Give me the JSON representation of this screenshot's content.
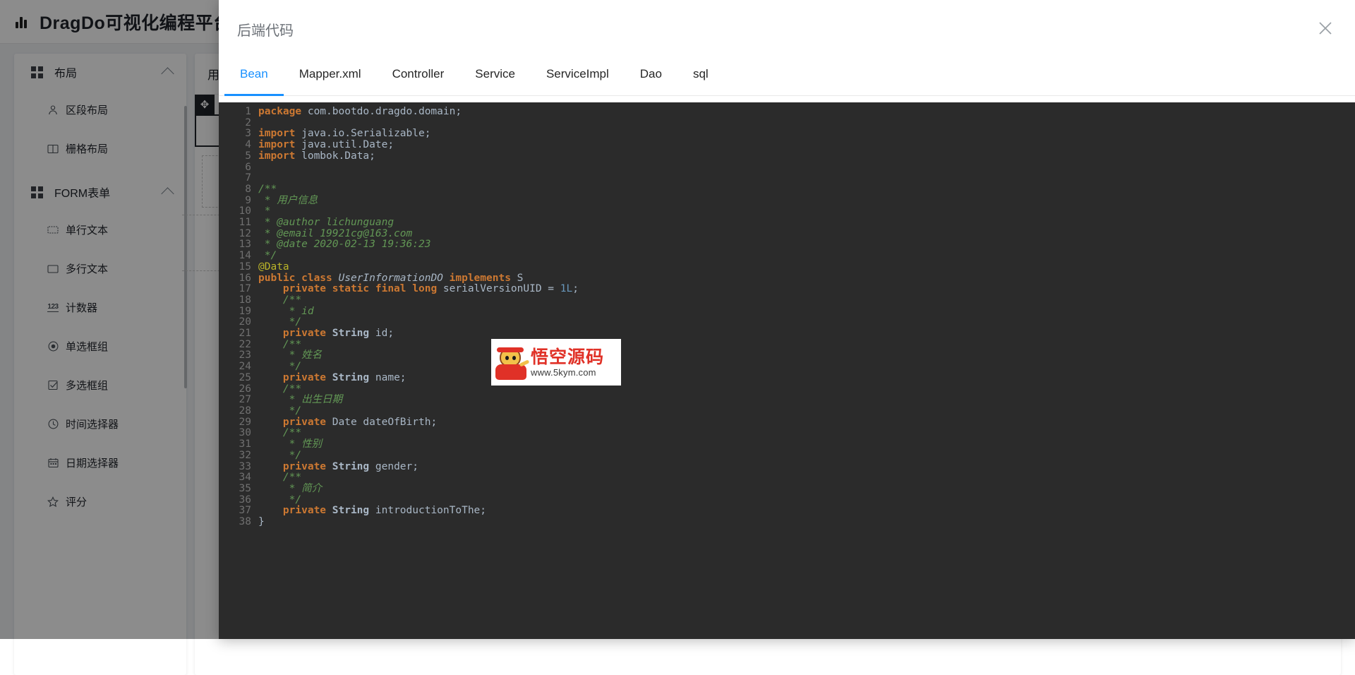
{
  "app": {
    "brand_title": "DragDo可视化编程平台",
    "brand_icon": "bar-chart-icon"
  },
  "sidebar": {
    "groups": [
      {
        "label": "布局",
        "icon": "grid-icon",
        "chevron": "chevron-up-icon",
        "items": [
          {
            "label": "区段布局",
            "icon": "person-icon"
          },
          {
            "label": "栅格布局",
            "icon": "columns-icon"
          }
        ]
      },
      {
        "label": "FORM表单",
        "icon": "grid-icon",
        "chevron": "chevron-up-icon",
        "items": [
          {
            "label": "单行文本",
            "icon": "input-icon"
          },
          {
            "label": "多行文本",
            "icon": "textarea-icon"
          },
          {
            "label": "计数器",
            "icon": "number-123-icon"
          },
          {
            "label": "单选框组",
            "icon": "radio-icon"
          },
          {
            "label": "多选框组",
            "icon": "checkbox-icon"
          },
          {
            "label": "时间选择器",
            "icon": "clock-icon"
          },
          {
            "label": "日期选择器",
            "icon": "calendar-icon"
          },
          {
            "label": "评分",
            "icon": "star-icon"
          }
        ]
      }
    ]
  },
  "canvas": {
    "tab_label": "用户",
    "drag_handle_icon": "move-icon"
  },
  "modal": {
    "title": "后端代码",
    "close_icon": "close-icon",
    "tabs": [
      {
        "label": "Bean",
        "active": true
      },
      {
        "label": "Mapper.xml",
        "active": false
      },
      {
        "label": "Controller",
        "active": false
      },
      {
        "label": "Service",
        "active": false
      },
      {
        "label": "ServiceImpl",
        "active": false
      },
      {
        "label": "Dao",
        "active": false
      },
      {
        "label": "sql",
        "active": false
      }
    ],
    "code": {
      "language": "java",
      "first_line": 1,
      "last_line": 38,
      "lines": [
        {
          "n": 1,
          "tokens": [
            {
              "t": "package",
              "c": "k"
            },
            {
              "t": " com.bootdo.dragdo.domain;",
              "c": "w"
            }
          ]
        },
        {
          "n": 2,
          "tokens": []
        },
        {
          "n": 3,
          "tokens": [
            {
              "t": "import",
              "c": "k"
            },
            {
              "t": " java.io.Serializable;",
              "c": "w"
            }
          ]
        },
        {
          "n": 4,
          "tokens": [
            {
              "t": "import",
              "c": "k"
            },
            {
              "t": " java.util.Date;",
              "c": "w"
            }
          ]
        },
        {
          "n": 5,
          "tokens": [
            {
              "t": "import",
              "c": "k"
            },
            {
              "t": " lombok.Data;",
              "c": "w"
            }
          ]
        },
        {
          "n": 6,
          "tokens": []
        },
        {
          "n": 7,
          "tokens": []
        },
        {
          "n": 8,
          "tokens": [
            {
              "t": "/**",
              "c": "cm"
            }
          ]
        },
        {
          "n": 9,
          "tokens": [
            {
              "t": " * 用户信息",
              "c": "cm"
            }
          ]
        },
        {
          "n": 10,
          "tokens": [
            {
              "t": " *",
              "c": "cm"
            }
          ]
        },
        {
          "n": 11,
          "tokens": [
            {
              "t": " * @author lichunguang",
              "c": "cm"
            }
          ]
        },
        {
          "n": 12,
          "tokens": [
            {
              "t": " * @email 19921cg@163.com",
              "c": "cm"
            }
          ]
        },
        {
          "n": 13,
          "tokens": [
            {
              "t": " * @date 2020-02-13 19:36:23",
              "c": "cm"
            }
          ]
        },
        {
          "n": 14,
          "tokens": [
            {
              "t": " */",
              "c": "cm"
            }
          ]
        },
        {
          "n": 15,
          "tokens": [
            {
              "t": "@Data",
              "c": "an"
            }
          ]
        },
        {
          "n": 16,
          "tokens": [
            {
              "t": "public class ",
              "c": "k"
            },
            {
              "t": "UserInformationDO",
              "c": "ty"
            },
            {
              "t": " implements ",
              "c": "k"
            },
            {
              "t": "S",
              "c": "w"
            }
          ]
        },
        {
          "n": 17,
          "tokens": [
            {
              "t": "    private static final ",
              "c": "k"
            },
            {
              "t": "long",
              "c": "k"
            },
            {
              "t": " serialVersionUID = ",
              "c": "w"
            },
            {
              "t": "1L",
              "c": "num"
            },
            {
              "t": ";",
              "c": "w"
            }
          ]
        },
        {
          "n": 18,
          "tokens": [
            {
              "t": "    /**",
              "c": "cm"
            }
          ]
        },
        {
          "n": 19,
          "tokens": [
            {
              "t": "     * id",
              "c": "cm"
            }
          ]
        },
        {
          "n": 20,
          "tokens": [
            {
              "t": "     */",
              "c": "cm"
            }
          ]
        },
        {
          "n": 21,
          "tokens": [
            {
              "t": "    private ",
              "c": "k"
            },
            {
              "t": "String",
              "c": "bold"
            },
            {
              "t": " id;",
              "c": "w"
            }
          ]
        },
        {
          "n": 22,
          "tokens": [
            {
              "t": "    /**",
              "c": "cm"
            }
          ]
        },
        {
          "n": 23,
          "tokens": [
            {
              "t": "     * 姓名",
              "c": "cm"
            }
          ]
        },
        {
          "n": 24,
          "tokens": [
            {
              "t": "     */",
              "c": "cm"
            }
          ]
        },
        {
          "n": 25,
          "tokens": [
            {
              "t": "    private ",
              "c": "k"
            },
            {
              "t": "String",
              "c": "bold"
            },
            {
              "t": " name;",
              "c": "w"
            }
          ]
        },
        {
          "n": 26,
          "tokens": [
            {
              "t": "    /**",
              "c": "cm"
            }
          ]
        },
        {
          "n": 27,
          "tokens": [
            {
              "t": "     * 出生日期",
              "c": "cm"
            }
          ]
        },
        {
          "n": 28,
          "tokens": [
            {
              "t": "     */",
              "c": "cm"
            }
          ]
        },
        {
          "n": 29,
          "tokens": [
            {
              "t": "    private ",
              "c": "k"
            },
            {
              "t": "Date dateOfBirth;",
              "c": "w"
            }
          ]
        },
        {
          "n": 30,
          "tokens": [
            {
              "t": "    /**",
              "c": "cm"
            }
          ]
        },
        {
          "n": 31,
          "tokens": [
            {
              "t": "     * 性别",
              "c": "cm"
            }
          ]
        },
        {
          "n": 32,
          "tokens": [
            {
              "t": "     */",
              "c": "cm"
            }
          ]
        },
        {
          "n": 33,
          "tokens": [
            {
              "t": "    private ",
              "c": "k"
            },
            {
              "t": "String",
              "c": "bold"
            },
            {
              "t": " gender;",
              "c": "w"
            }
          ]
        },
        {
          "n": 34,
          "tokens": [
            {
              "t": "    /**",
              "c": "cm"
            }
          ]
        },
        {
          "n": 35,
          "tokens": [
            {
              "t": "     * 简介",
              "c": "cm"
            }
          ]
        },
        {
          "n": 36,
          "tokens": [
            {
              "t": "     */",
              "c": "cm"
            }
          ]
        },
        {
          "n": 37,
          "tokens": [
            {
              "t": "    private ",
              "c": "k"
            },
            {
              "t": "String",
              "c": "bold"
            },
            {
              "t": " introductionToThe;",
              "c": "w"
            }
          ]
        },
        {
          "n": 38,
          "tokens": [
            {
              "t": "}",
              "c": "w"
            }
          ]
        }
      ]
    }
  },
  "watermark": {
    "cn_text": "悟空源码",
    "url_text": "www.5kym.com",
    "logo_icon": "monkey-king-logo-icon"
  },
  "colors": {
    "accent": "#1890ff",
    "editor_bg": "#2b2b2b",
    "keyword": "#cc7832",
    "comment": "#629755",
    "annotation": "#bbb529",
    "number": "#6897bb",
    "watermark_red": "#e03127"
  }
}
